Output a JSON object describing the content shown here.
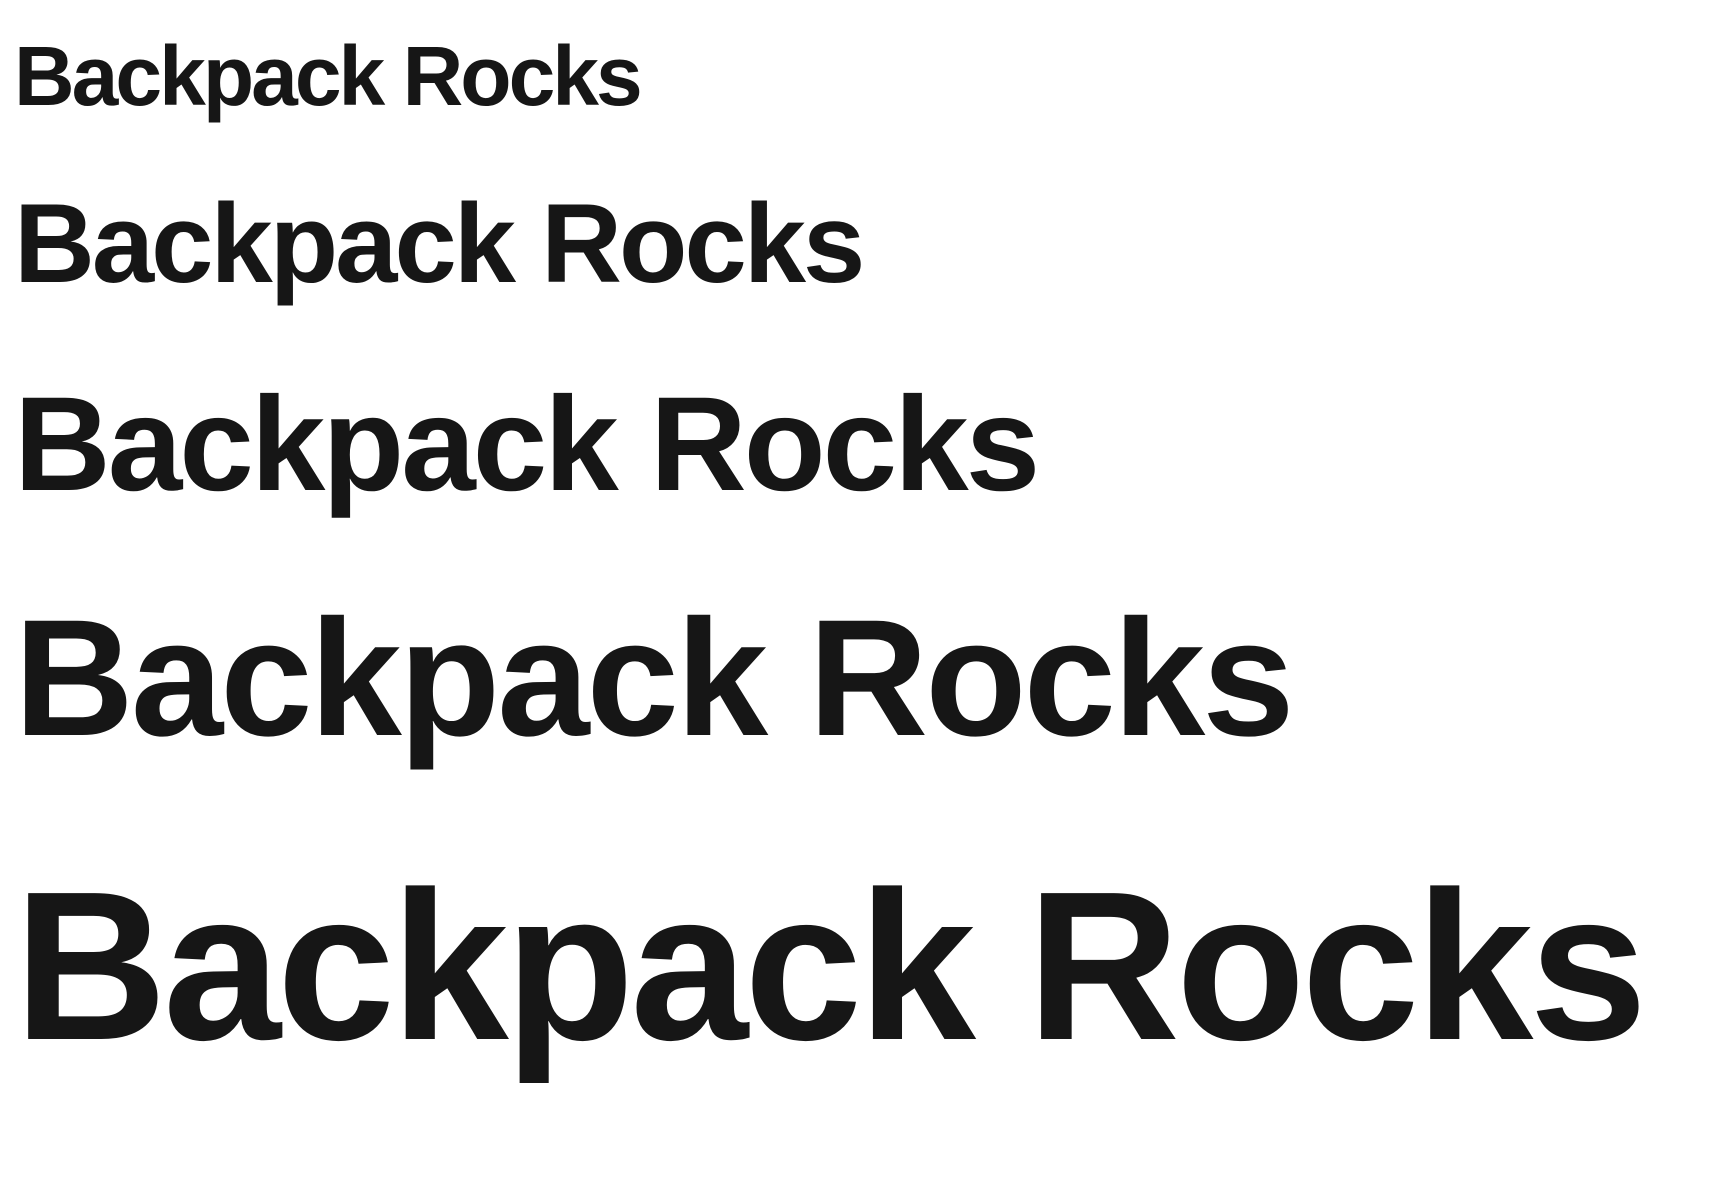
{
  "specimen": {
    "lines": [
      "Backpack Rocks",
      "Backpack Rocks",
      "Backpack Rocks",
      "Backpack Rocks",
      "Backpack Rocks"
    ]
  },
  "colors": {
    "text": "#161616",
    "background": "#ffffff"
  }
}
